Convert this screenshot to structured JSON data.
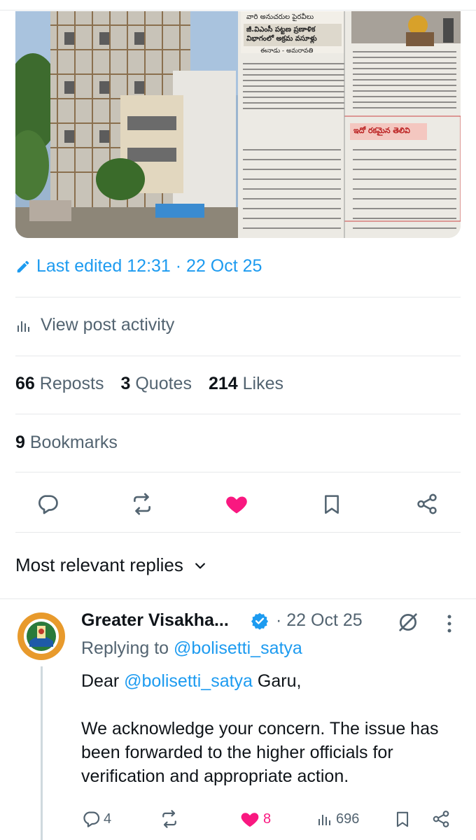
{
  "post": {
    "last_edited": "Last edited 12:31 · 22 Oct 25",
    "view_activity": "View post activity",
    "stats": {
      "reposts_count": "66",
      "reposts_label": "Reposts",
      "quotes_count": "3",
      "quotes_label": "Quotes",
      "likes_count": "214",
      "likes_label": "Likes",
      "bookmarks_count": "9",
      "bookmarks_label": "Bookmarks"
    },
    "liked": true
  },
  "media": {
    "newspaper": {
      "kicker": "వారి అనుచరుల పైరవీలు",
      "headline": "జీ.విఎంసీ పట్టణ ప్రణాళిక విభాగంలో అక్రమ వసూళ్లు",
      "dateline": "ఈనాడు - అమరావతి",
      "sidebar_title": "ఇదో రకమైన తెలివి"
    }
  },
  "replies_section": {
    "label": "Most relevant replies"
  },
  "reply": {
    "author_name": "Greater Visakha...",
    "dot": "·",
    "date": "22 Oct 25",
    "replying_prefix": "Replying to",
    "replying_handle": "@bolisetti_satya",
    "greeting_prefix": "Dear",
    "greeting_handle": "@bolisetti_satya",
    "greeting_suffix": "Garu,",
    "body": "We acknowledge your concern. The issue has been forwarded to the higher officials for verification and appropriate action.",
    "comments": "4",
    "likes": "8",
    "views": "696"
  },
  "colors": {
    "accent": "#1d9bf0",
    "like_pink": "#f91880",
    "muted": "#536471",
    "verified": "#1d9bf0"
  },
  "icons": [
    "edit-icon",
    "bar-chart-icon",
    "reply-icon",
    "repost-icon",
    "heart-icon",
    "bookmark-icon",
    "share-icon",
    "chevron-down-icon",
    "verified-badge-icon",
    "grok-icon",
    "more-icon",
    "views-icon"
  ]
}
